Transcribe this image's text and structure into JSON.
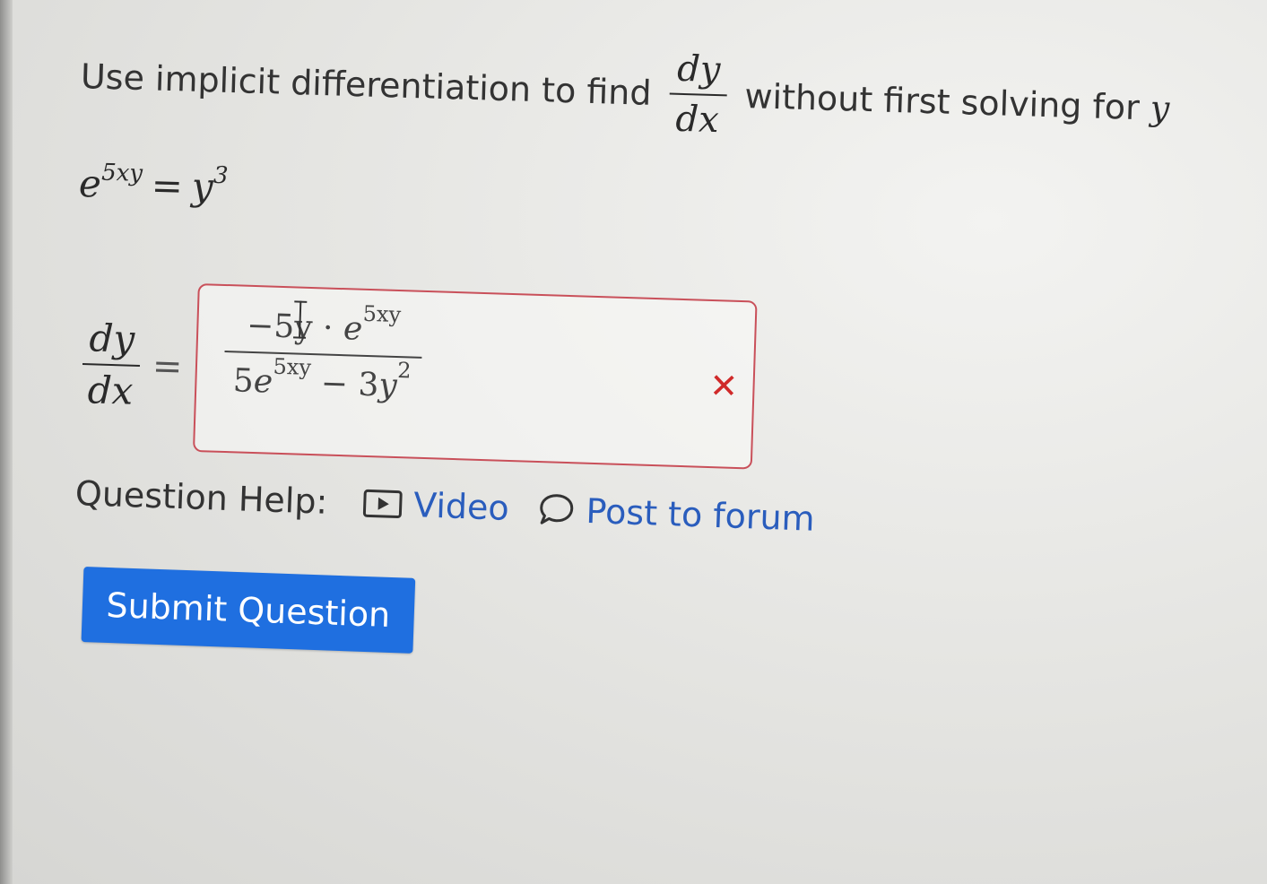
{
  "question": {
    "prompt_before": "Use implicit differentiation to find",
    "derivative_numerator": "dy",
    "derivative_denominator": "dx",
    "prompt_after": "without first solving for",
    "prompt_variable": "y",
    "equation": {
      "base": "e",
      "exponent": "5xy",
      "equals": "=",
      "rhs": "y",
      "rhs_exponent": "3"
    }
  },
  "answer": {
    "lhs_numerator": "dy",
    "lhs_denominator": "dx",
    "equals": "=",
    "numerator_coeff": "−5y · ",
    "numerator_base": "e",
    "numerator_exponent": "5xy",
    "denominator_coeff": "5",
    "denominator_base": "e",
    "denominator_exponent": "5xy",
    "denominator_rest": " − 3",
    "denominator_var": "y",
    "denominator_var_exponent": "2",
    "status": "incorrect",
    "status_icon": "✕",
    "status_color": "#d02a2a",
    "border_color": "#c9505a"
  },
  "help": {
    "label": "Question Help:",
    "video_label": "Video",
    "video_icon": "video-play-icon",
    "forum_label": "Post to forum",
    "forum_icon": "speech-bubble-icon",
    "link_color": "#2a5dbd"
  },
  "submit": {
    "label": "Submit Question",
    "color": "#1f6fe0"
  }
}
